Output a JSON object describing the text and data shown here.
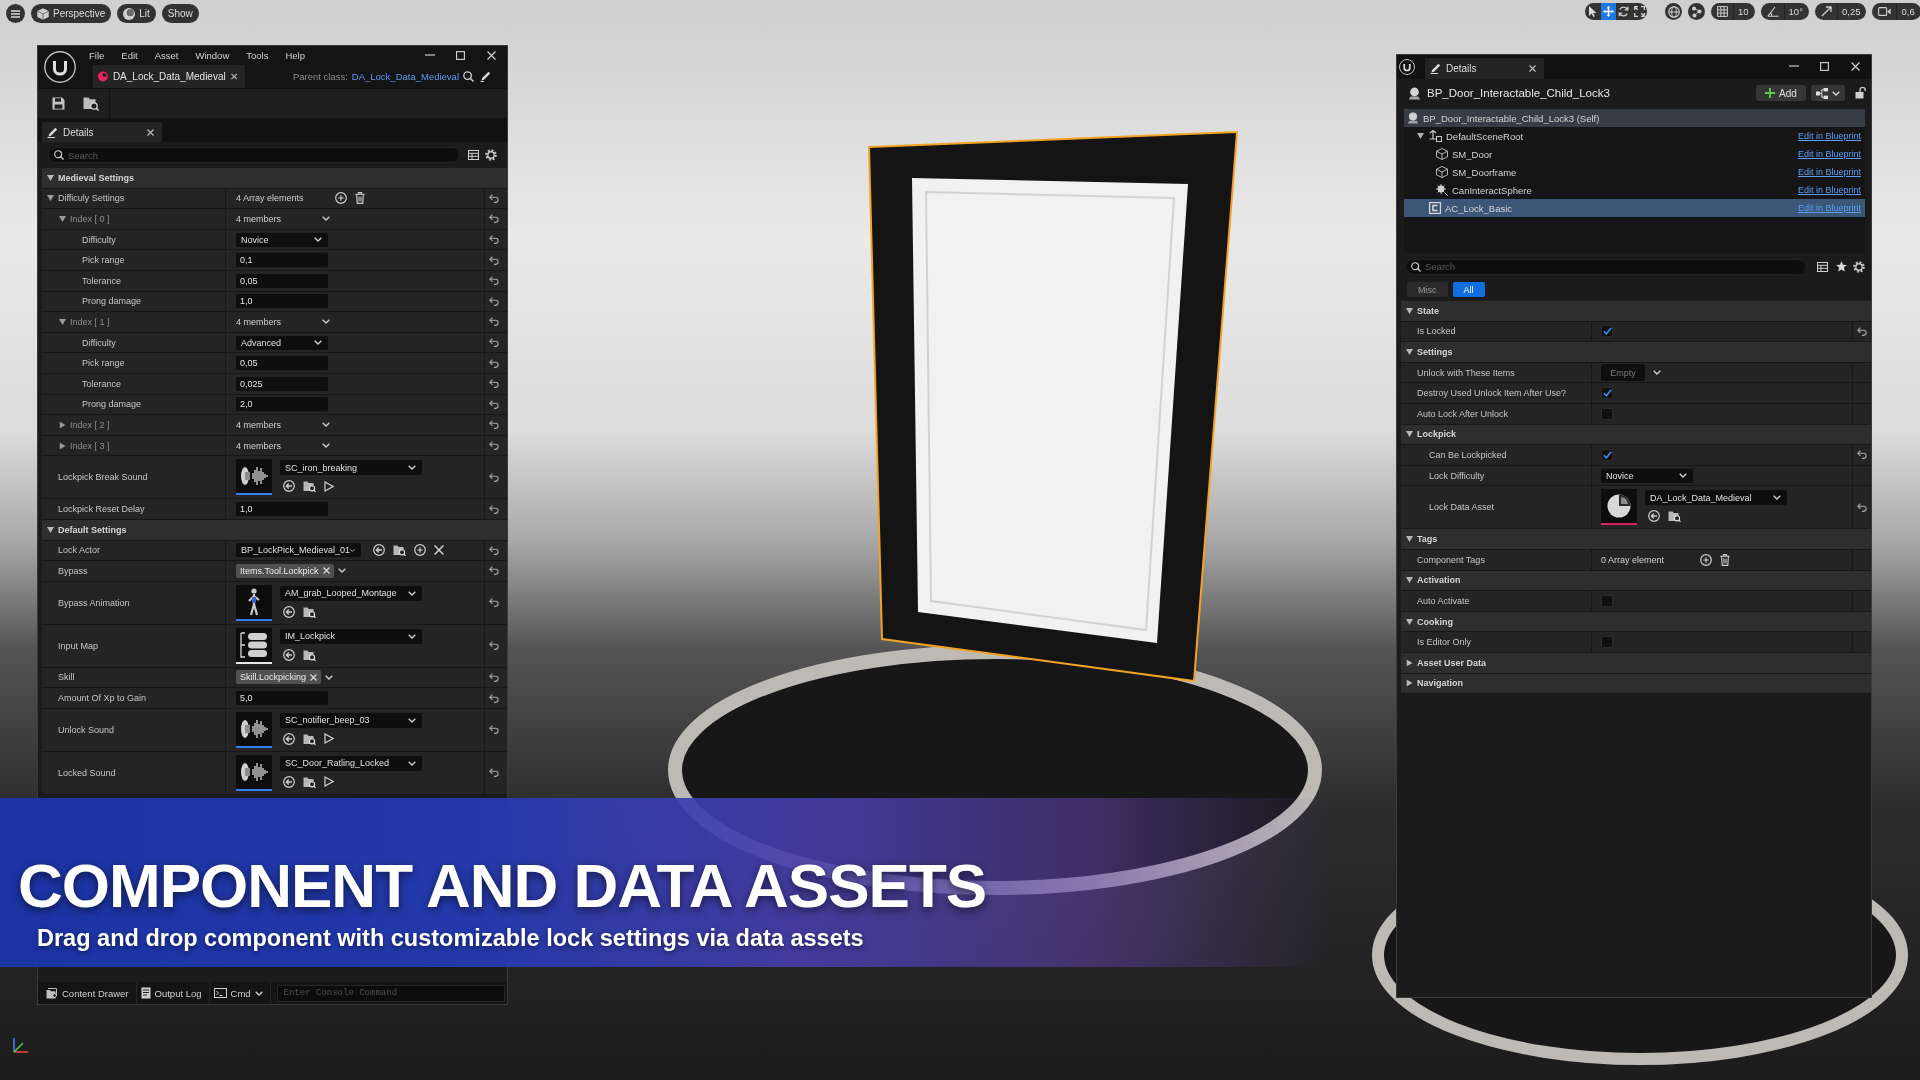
{
  "viewport_toolbar": {
    "view_mode": "Perspective",
    "lighting": "Lit",
    "show": "Show"
  },
  "transform_toolbar": {
    "tools": [
      {
        "selected": false
      },
      {
        "selected": true
      },
      {
        "selected": false
      },
      {
        "selected": false
      }
    ],
    "grid_snap": "10",
    "rotation_snap": "10°",
    "scale_snap": "0,25",
    "camera_speed": "0,6"
  },
  "asset_editor": {
    "menu": [
      "File",
      "Edit",
      "Asset",
      "Window",
      "Tools",
      "Help"
    ],
    "tab": "DA_Lock_Data_Medieval",
    "parent_class_label": "Parent class:",
    "parent_class": "DA_Lock_Data_Medieval",
    "details_tab": "Details",
    "search": {
      "placeholder": "Search"
    },
    "rows": [
      {
        "kind": "category",
        "label": "Medieval Settings",
        "expanded": true,
        "children": [
          {
            "kind": "array",
            "label": "Difficuly Settings",
            "expanded": true,
            "value": "4 Array elements",
            "reset": true,
            "children": [
              {
                "kind": "struct",
                "label": "Index [ 0 ]",
                "expanded": true,
                "value": "4 members",
                "reset": true,
                "children": [
                  {
                    "kind": "enum",
                    "label": "Difficulty",
                    "value": "Novice",
                    "reset": true
                  },
                  {
                    "kind": "number",
                    "label": "Pick range",
                    "value": "0,1",
                    "reset": true
                  },
                  {
                    "kind": "number",
                    "label": "Tolerance",
                    "value": "0,05",
                    "reset": true
                  },
                  {
                    "kind": "number",
                    "label": "Prong damage",
                    "value": "1,0",
                    "reset": true
                  }
                ]
              },
              {
                "kind": "struct",
                "label": "Index [ 1 ]",
                "expanded": true,
                "value": "4 members",
                "reset": true,
                "children": [
                  {
                    "kind": "enum",
                    "label": "Difficulty",
                    "value": "Advanced",
                    "reset": true
                  },
                  {
                    "kind": "number",
                    "label": "Pick range",
                    "value": "0,05",
                    "reset": true
                  },
                  {
                    "kind": "number",
                    "label": "Tolerance",
                    "value": "0,025",
                    "reset": true
                  },
                  {
                    "kind": "number",
                    "label": "Prong damage",
                    "value": "2,0",
                    "reset": true
                  }
                ]
              },
              {
                "kind": "struct",
                "label": "Index [ 2 ]",
                "expanded": false,
                "value": "4 members",
                "reset": true
              },
              {
                "kind": "struct",
                "label": "Index [ 3 ]",
                "expanded": false,
                "value": "4 members",
                "reset": true
              }
            ]
          },
          {
            "kind": "sound",
            "label": "Lockpick Break Sound",
            "value": "SC_iron_breaking",
            "reset": true
          },
          {
            "kind": "number",
            "label": "Lockpick Reset Delay",
            "value": "1,0",
            "reset": true
          }
        ]
      },
      {
        "kind": "category",
        "label": "Default Settings",
        "expanded": true,
        "children": [
          {
            "kind": "actorclass",
            "label": "Lock Actor",
            "value": "BP_LockPick_Medieval_01",
            "reset": true
          },
          {
            "kind": "tag",
            "label": "Bypass",
            "value": "Items.Tool.Lockpick",
            "reset": true
          },
          {
            "kind": "animation",
            "label": "Bypass Animation",
            "value": "AM_grab_Looped_Montage",
            "reset": true
          },
          {
            "kind": "inputmap",
            "label": "Input Map",
            "value": "IM_Lockpick",
            "reset": true
          },
          {
            "kind": "tag",
            "label": "Skill",
            "value": "Skill.Lockpicking",
            "reset": true
          },
          {
            "kind": "number",
            "label": "Amount Of Xp to Gain",
            "value": "5,0",
            "reset": true
          },
          {
            "kind": "sound",
            "label": "Unlock Sound",
            "value": "SC_notifier_beep_03",
            "reset": true
          },
          {
            "kind": "sound",
            "label": "Locked Sound",
            "value": "SC_Door_Ratling_Locked",
            "reset": true
          }
        ]
      }
    ],
    "bottom_bar": {
      "content_drawer": "Content Drawer",
      "output_log": "Output Log",
      "cmd": "Cmd",
      "console": {
        "placeholder": "Enter Console Command"
      }
    }
  },
  "details_panel": {
    "tab": "Details",
    "actor": "BP_Door_Interactable_Child_Lock3",
    "add_button": "Add",
    "components": [
      {
        "kind": "actor",
        "label": "BP_Door_Interactable_Child_Lock3 (Self)",
        "selected": false,
        "children": [
          {
            "kind": "scene",
            "label": "DefaultSceneRoot",
            "expanded": true,
            "selected": false,
            "link": "Edit in Blueprint",
            "children": [
              {
                "kind": "mesh",
                "label": "SM_Door",
                "selected": false,
                "link": "Edit in Blueprint"
              },
              {
                "kind": "mesh",
                "label": "SM_Doorframe",
                "selected": false,
                "link": "Edit in Blueprint"
              },
              {
                "kind": "sphere",
                "label": "CanInteractSphere",
                "selected": false,
                "link": "Edit in Blueprint"
              }
            ]
          },
          {
            "kind": "component",
            "label": "AC_Lock_Basic",
            "selected": true,
            "link": "Edit in Blueprint"
          }
        ]
      }
    ],
    "search": {
      "placeholder": "Search"
    },
    "filters": [
      {
        "label": "Misc",
        "selected": false
      },
      {
        "label": "All",
        "selected": true
      }
    ],
    "rows": [
      {
        "kind": "category",
        "label": "State",
        "expanded": true,
        "children": [
          {
            "kind": "checkbox",
            "label": "Is Locked",
            "checked": true,
            "reset": true
          }
        ]
      },
      {
        "kind": "category",
        "label": "Settings",
        "expanded": true,
        "children": [
          {
            "kind": "emptytag",
            "label": "Unlock with These Items",
            "value": "Empty",
            "reset": false
          },
          {
            "kind": "checkbox",
            "label": "Destroy Used Unlock Item After Use?",
            "checked": true,
            "reset": false
          },
          {
            "kind": "checkbox",
            "label": "Auto Lock After Unlock",
            "checked": false,
            "reset": false
          },
          {
            "kind": "category",
            "label": "Lockpick",
            "expanded": true,
            "children": [
              {
                "kind": "checkbox",
                "label": "Can Be Lockpicked",
                "checked": true,
                "reset": true
              },
              {
                "kind": "enum",
                "label": "Lock Difficulty",
                "value": "Novice",
                "reset": false
              },
              {
                "kind": "dataasset",
                "label": "Lock Data Asset",
                "value": "DA_Lock_Data_Medieval",
                "reset": true
              }
            ]
          }
        ]
      },
      {
        "kind": "category",
        "label": "Tags",
        "expanded": true,
        "children": [
          {
            "kind": "array",
            "label": "Component Tags",
            "value": "0 Array element",
            "reset": false
          }
        ]
      },
      {
        "kind": "category",
        "label": "Activation",
        "expanded": true,
        "children": [
          {
            "kind": "checkbox",
            "label": "Auto Activate",
            "checked": false,
            "reset": false
          }
        ]
      },
      {
        "kind": "category",
        "label": "Cooking",
        "expanded": true,
        "children": [
          {
            "kind": "checkbox",
            "label": "Is Editor Only",
            "checked": false,
            "reset": false
          }
        ]
      },
      {
        "kind": "category",
        "label": "Asset User Data",
        "expanded": false
      },
      {
        "kind": "category",
        "label": "Navigation",
        "expanded": false
      }
    ]
  },
  "banner": {
    "title": "COMPONENT AND DATA ASSETS",
    "subtitle": "Drag and drop component with customizable lock settings via data assets"
  }
}
